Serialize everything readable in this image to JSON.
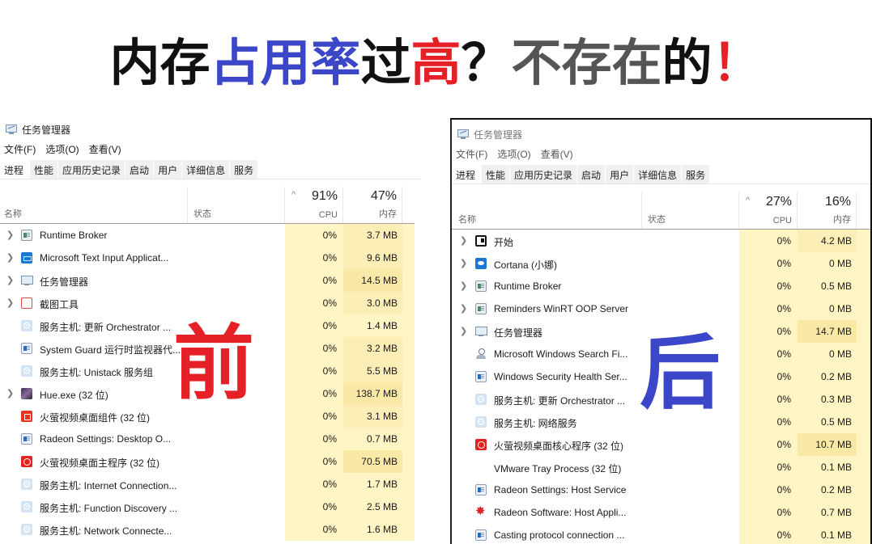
{
  "headline": [
    {
      "text": "内存",
      "color": "#111111"
    },
    {
      "text": "占用率",
      "color": "#3c46c8"
    },
    {
      "text": "过",
      "color": "#111111"
    },
    {
      "text": "高",
      "color": "#e52127"
    },
    {
      "text": "？",
      "color": "#111111"
    },
    {
      "text": "不存在",
      "color": "#555555"
    },
    {
      "text": "的",
      "color": "#111111"
    },
    {
      "text": "！",
      "color": "#e52127"
    }
  ],
  "stamps": {
    "before": {
      "text": "前",
      "color": "#e52127"
    },
    "after": {
      "text": "后",
      "color": "#3c46c8"
    }
  },
  "colors": {
    "cpu_cell": "#fff4c4",
    "mem_cell_light": "#fff4c4",
    "mem_cell_dark": "#f9e8a6"
  },
  "left": {
    "title": "任务管理器",
    "menu": [
      "文件(F)",
      "选项(O)",
      "查看(V)"
    ],
    "tabs": [
      "进程",
      "性能",
      "应用历史记录",
      "启动",
      "用户",
      "详细信息",
      "服务"
    ],
    "active_tab": "进程",
    "columns": {
      "name": "名称",
      "status": "状态",
      "cpu_label": "CPU",
      "cpu_total": "91%",
      "mem_label": "内存",
      "mem_total": "47%",
      "sort_indicator": "^"
    },
    "rows": [
      {
        "expand": true,
        "icon": "window",
        "name": "Runtime Broker",
        "cpu": "0%",
        "mem": "3.7 MB"
      },
      {
        "expand": true,
        "icon": "keyboard",
        "name": "Microsoft Text Input Applicat...",
        "cpu": "0%",
        "mem": "9.6 MB"
      },
      {
        "expand": true,
        "icon": "taskmgr",
        "name": "任务管理器",
        "cpu": "0%",
        "mem": "14.5 MB"
      },
      {
        "expand": true,
        "icon": "snip",
        "name": "截图工具",
        "cpu": "0%",
        "mem": "3.0 MB"
      },
      {
        "expand": false,
        "icon": "gear",
        "name": "服务主机: 更新 Orchestrator ...",
        "cpu": "0%",
        "mem": "1.4 MB"
      },
      {
        "expand": false,
        "icon": "window-blue",
        "name": "System Guard 运行时监视器代...",
        "cpu": "0%",
        "mem": "3.2 MB"
      },
      {
        "expand": false,
        "icon": "gear",
        "name": "服务主机: Unistack 服务组",
        "cpu": "0%",
        "mem": "5.5 MB"
      },
      {
        "expand": true,
        "icon": "hue",
        "name": "Hue.exe (32 位)",
        "cpu": "0%",
        "mem": "138.7 MB"
      },
      {
        "expand": false,
        "icon": "firefly",
        "name": "火萤视频桌面组件 (32 位)",
        "cpu": "0%",
        "mem": "3.1 MB"
      },
      {
        "expand": false,
        "icon": "window-blue",
        "name": "Radeon Settings: Desktop O...",
        "cpu": "0%",
        "mem": "0.7 MB"
      },
      {
        "expand": false,
        "icon": "firefly-main",
        "name": "火萤视频桌面主程序 (32 位)",
        "cpu": "0%",
        "mem": "70.5 MB"
      },
      {
        "expand": false,
        "icon": "gear",
        "name": "服务主机: Internet Connection...",
        "cpu": "0%",
        "mem": "1.7 MB"
      },
      {
        "expand": false,
        "icon": "gear",
        "name": "服务主机: Function Discovery ...",
        "cpu": "0%",
        "mem": "2.5 MB"
      },
      {
        "expand": false,
        "icon": "gear",
        "name": "服务主机: Network Connecte...",
        "cpu": "0%",
        "mem": "1.6 MB"
      }
    ]
  },
  "right": {
    "title": "任务管理器",
    "menu": [
      "文件(F)",
      "选项(O)",
      "查看(V)"
    ],
    "tabs": [
      "进程",
      "性能",
      "应用历史记录",
      "启动",
      "用户",
      "详细信息",
      "服务"
    ],
    "active_tab": "进程",
    "columns": {
      "name": "名称",
      "status": "状态",
      "cpu_label": "CPU",
      "cpu_total": "27%",
      "mem_label": "内存",
      "mem_total": "16%",
      "sort_indicator": "^"
    },
    "rows": [
      {
        "expand": true,
        "icon": "start",
        "name": "开始",
        "cpu": "0%",
        "mem": "4.2 MB"
      },
      {
        "expand": true,
        "icon": "cortana",
        "name": "Cortana (小娜)",
        "cpu": "0%",
        "mem": "0 MB"
      },
      {
        "expand": true,
        "icon": "window",
        "name": "Runtime Broker",
        "cpu": "0%",
        "mem": "0.5 MB"
      },
      {
        "expand": true,
        "icon": "window",
        "name": "Reminders WinRT OOP Server",
        "cpu": "0%",
        "mem": "0 MB"
      },
      {
        "expand": true,
        "icon": "taskmgr",
        "name": "任务管理器",
        "cpu": "0%",
        "mem": "14.7 MB"
      },
      {
        "expand": false,
        "icon": "search",
        "name": "Microsoft Windows Search Fi...",
        "cpu": "0%",
        "mem": "0 MB"
      },
      {
        "expand": false,
        "icon": "window-blue",
        "name": "Windows Security Health Ser...",
        "cpu": "0%",
        "mem": "0.2 MB"
      },
      {
        "expand": false,
        "icon": "gear",
        "name": "服务主机: 更新 Orchestrator ...",
        "cpu": "0%",
        "mem": "0.3 MB"
      },
      {
        "expand": false,
        "icon": "gear",
        "name": "服务主机: 网络服务",
        "cpu": "0%",
        "mem": "0.5 MB"
      },
      {
        "expand": false,
        "icon": "firefly-main",
        "name": "火萤视频桌面核心程序 (32 位)",
        "cpu": "0%",
        "mem": "10.7 MB"
      },
      {
        "expand": false,
        "icon": "none",
        "name": "VMware Tray Process (32 位)",
        "cpu": "0%",
        "mem": "0.1 MB"
      },
      {
        "expand": false,
        "icon": "window-blue",
        "name": "Radeon Settings: Host Service",
        "cpu": "0%",
        "mem": "0.2 MB"
      },
      {
        "expand": false,
        "icon": "radeon",
        "name": "Radeon Software: Host Appli...",
        "cpu": "0%",
        "mem": "0.7 MB"
      },
      {
        "expand": false,
        "icon": "window-blue",
        "name": "Casting protocol connection ...",
        "cpu": "0%",
        "mem": "0.1 MB"
      }
    ]
  }
}
